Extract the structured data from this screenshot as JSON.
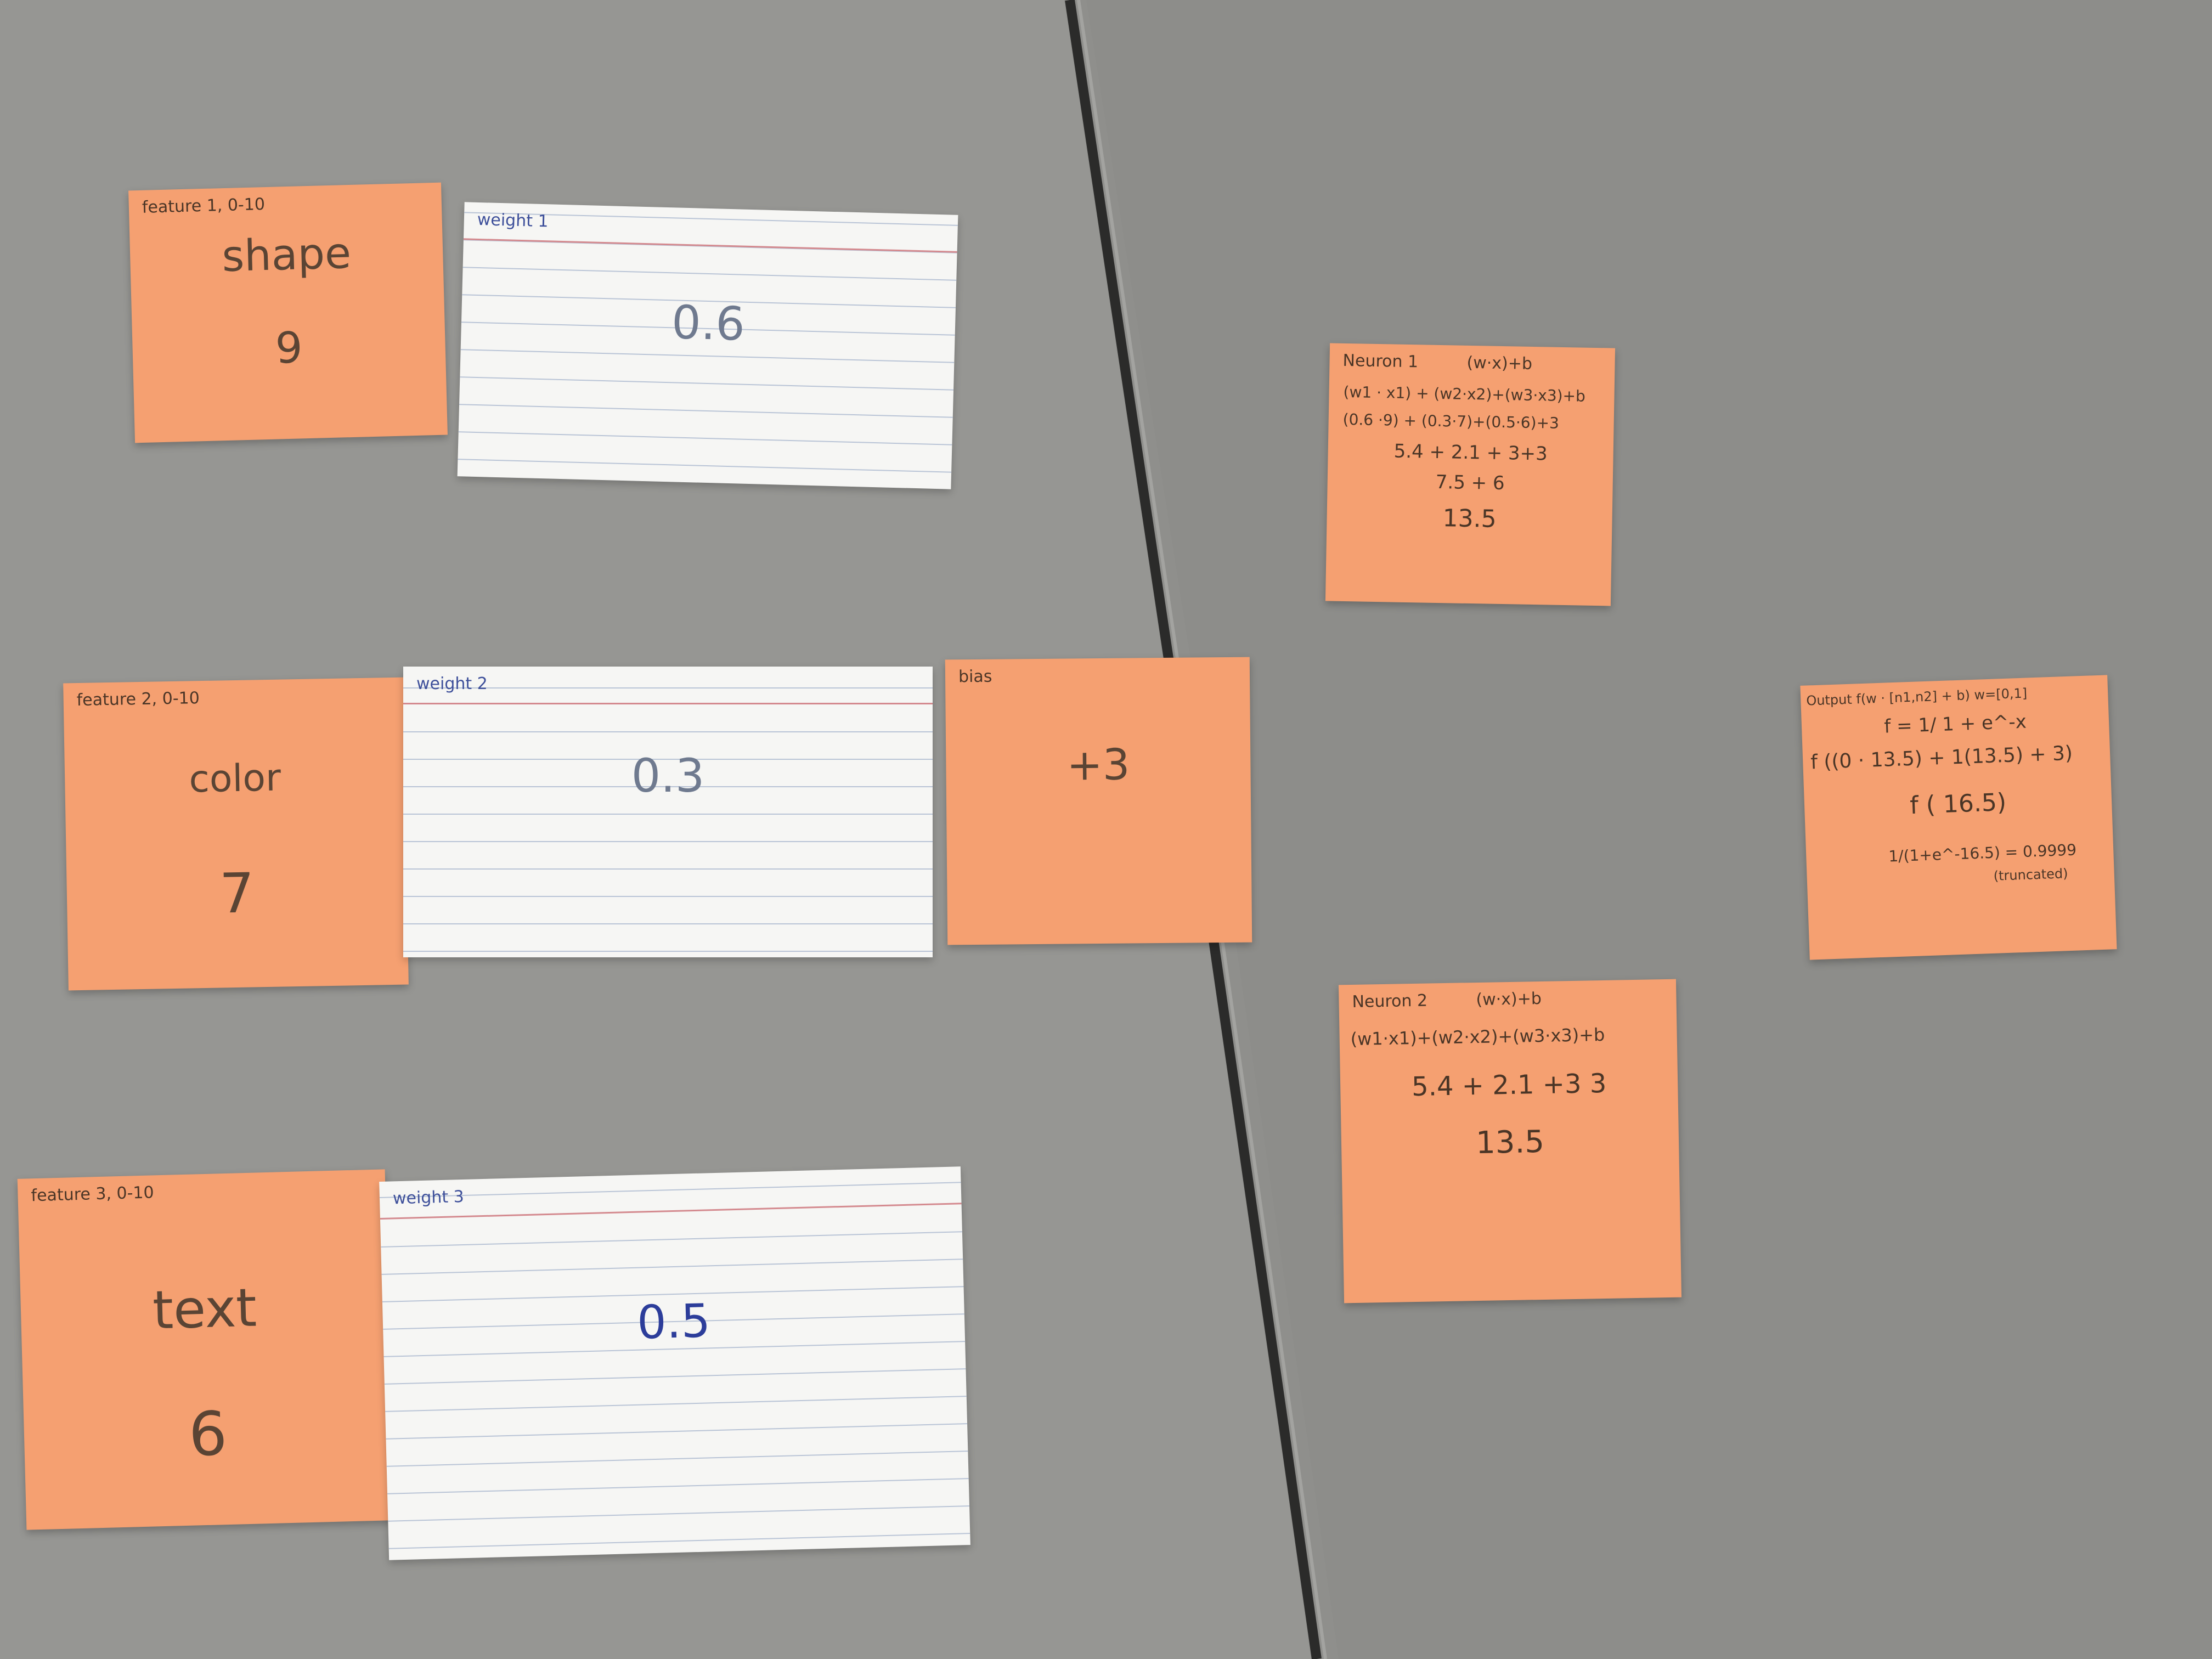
{
  "features": [
    {
      "label": "feature 1, 0-10",
      "name": "shape",
      "value": "9"
    },
    {
      "label": "feature 2, 0-10",
      "name": "color",
      "value": "7"
    },
    {
      "label": "feature 3, 0-10",
      "name": "text",
      "value": "6"
    }
  ],
  "weights": [
    {
      "label": "weight 1",
      "value": "0.6"
    },
    {
      "label": "weight 2",
      "value": "0.3"
    },
    {
      "label": "weight 3",
      "value": "0.5"
    }
  ],
  "bias": {
    "label": "bias",
    "value": "+3"
  },
  "neuron1": {
    "title": "Neuron 1",
    "formula": "(w·x)+b",
    "lines": [
      "(w1 · x1) + (w2·x2)+(w3·x3)+b",
      "(0.6 ·9) + (0.3·7)+(0.5·6)+3",
      "5.4 + 2.1 + 3+3",
      "7.5 + 6",
      "13.5"
    ]
  },
  "neuron2": {
    "title": "Neuron 2",
    "formula": "(w·x)+b",
    "lines": [
      "(w1·x1)+(w2·x2)+(w3·x3)+b",
      "5.4 + 2.1 +3 3",
      "13.5"
    ]
  },
  "output": {
    "title": "Output f(w · [n1,n2] + b)  w=[0,1]",
    "lines": [
      "f = 1/ 1 + e^-x",
      "f ((0 · 13.5) + 1(13.5) + 3)",
      "f ( 16.5)",
      "1/(1+e^-16.5) = 0.9999",
      "(truncated)"
    ]
  }
}
